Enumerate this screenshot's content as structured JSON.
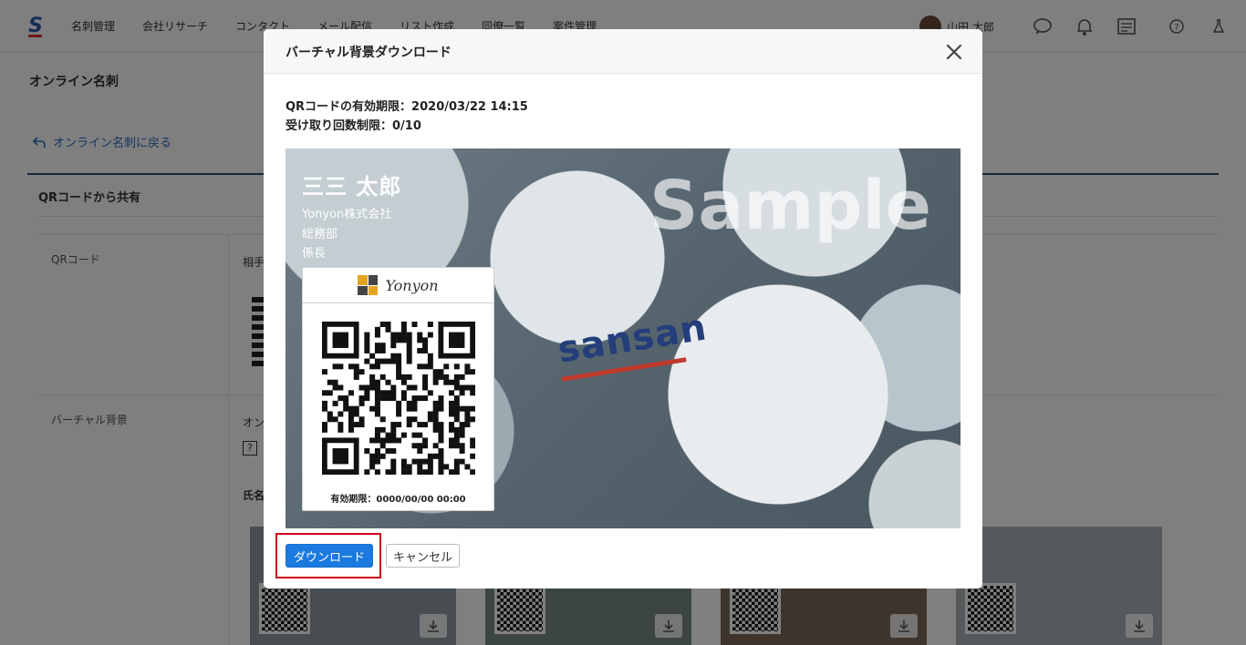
{
  "topnav": {
    "logo": "S",
    "items": [
      "名刺管理",
      "会社リサーチ",
      "コンタクト",
      "メール配信",
      "リスト作成",
      "同僚一覧",
      "案件管理"
    ],
    "user_name": "山田 太郎"
  },
  "page": {
    "title": "オンライン名刺",
    "back_link": "オンライン名刺に戻る",
    "section_title": "QRコードから共有",
    "row_qr_label": "QRコード",
    "row_qr_text": "相手",
    "row_vb_label": "バーチャル背景",
    "row_vb_text": "オン",
    "row_name_text": "氏名"
  },
  "modal": {
    "title": "バーチャル背景ダウンロード",
    "qr_expiry": "QRコードの有効期限：2020/03/22 14:15",
    "receive_limit": "受け取り回数制限：0/10",
    "download_button": "ダウンロード",
    "cancel_button": "キャンセル"
  },
  "preview": {
    "person_name": "三三 太郎",
    "company": "Yonyon株式会社",
    "department": "総務部",
    "position": "係長",
    "watermark": "Sample",
    "brand": "sansan",
    "card_company": "Yonyon",
    "card_expiry": "有効期限：0000/00/00 00:00"
  },
  "colors": {
    "primary": "#1a7ae0",
    "highlight": "#d0021b",
    "link": "#2a6cc4"
  }
}
